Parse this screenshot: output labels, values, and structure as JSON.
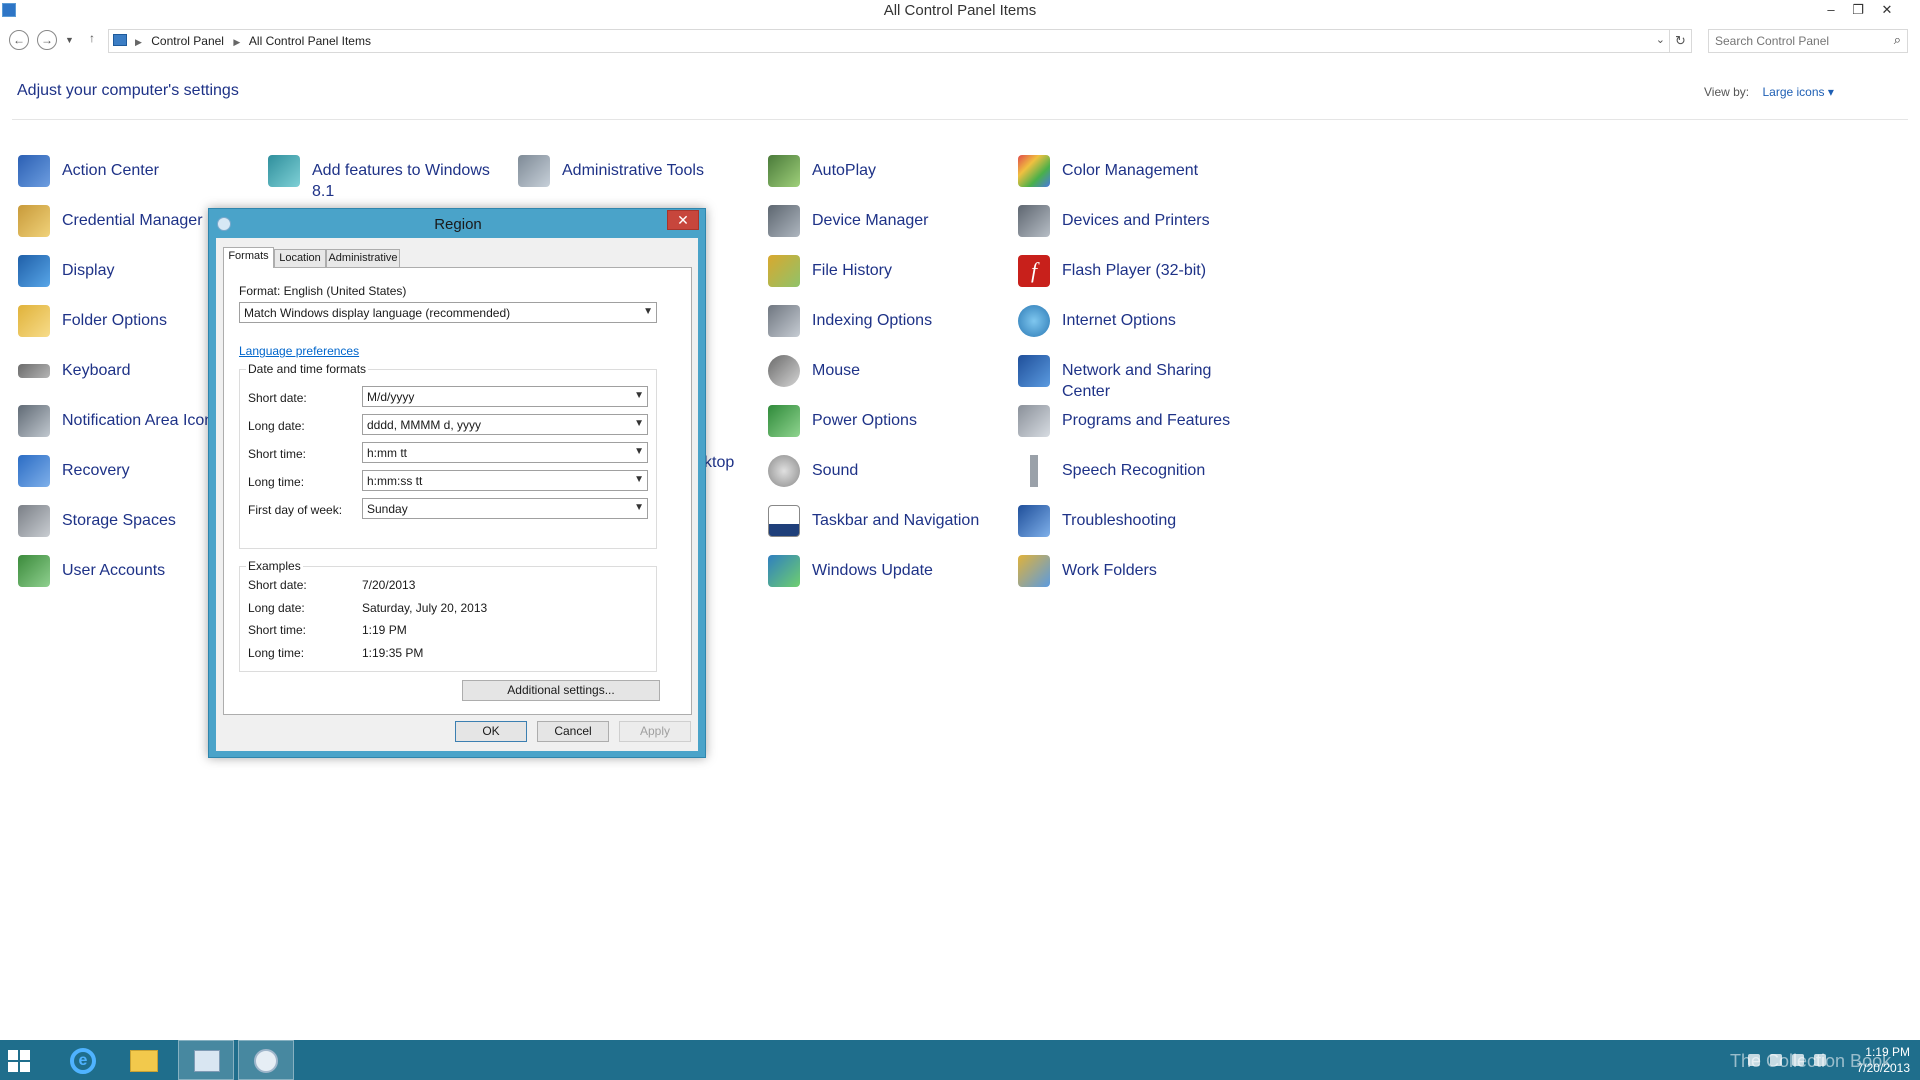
{
  "window": {
    "title": "All Control Panel Items",
    "minimize": "–",
    "restore": "❐",
    "close": "✕"
  },
  "address": {
    "crumbs": [
      "Control Panel",
      "All Control Panel Items"
    ],
    "search_placeholder": "Search Control Panel"
  },
  "header": {
    "heading": "Adjust your computer's settings",
    "view_by_label": "View by:",
    "view_by_value": "Large icons ▾"
  },
  "items": {
    "col1": [
      "Action Center",
      "Credential Manager",
      "Display",
      "Folder Options",
      "Keyboard",
      "Notification Area Icons",
      "Recovery",
      "Storage Spaces",
      "User Accounts"
    ],
    "col2": [
      "Add features to Windows 8.1"
    ],
    "col3": [
      "Administrative Tools",
      "ktop"
    ],
    "col4": [
      "AutoPlay",
      "Device Manager",
      "File History",
      "Indexing Options",
      "Mouse",
      "Power Options",
      "Sound",
      "Taskbar and Navigation",
      "Windows Update"
    ],
    "col5": [
      "Color Management",
      "Devices and Printers",
      "Flash Player (32-bit)",
      "Internet Options",
      "Network and Sharing Center",
      "Programs and Features",
      "Speech Recognition",
      "Troubleshooting",
      "Work Folders"
    ]
  },
  "dialog": {
    "title": "Region",
    "close": "✕",
    "tabs": [
      "Formats",
      "Location",
      "Administrative"
    ],
    "format_label": "Format: English (United States)",
    "format_value": "Match Windows display language (recommended)",
    "language_link": "Language preferences",
    "datetime_group": "Date and time formats",
    "fields": [
      {
        "label": "Short date:",
        "value": "M/d/yyyy"
      },
      {
        "label": "Long date:",
        "value": "dddd, MMMM d, yyyy"
      },
      {
        "label": "Short time:",
        "value": "h:mm tt"
      },
      {
        "label": "Long time:",
        "value": "h:mm:ss tt"
      },
      {
        "label": "First day of week:",
        "value": "Sunday"
      }
    ],
    "examples_group": "Examples",
    "examples": [
      {
        "label": "Short date:",
        "value": "7/20/2013"
      },
      {
        "label": "Long date:",
        "value": "Saturday, July 20, 2013"
      },
      {
        "label": "Short time:",
        "value": "1:19 PM"
      },
      {
        "label": "Long time:",
        "value": "1:19:35 PM"
      }
    ],
    "additional_settings": "Additional settings...",
    "ok": "OK",
    "cancel": "Cancel",
    "apply": "Apply"
  },
  "taskbar": {
    "watermark": "The Collection Book",
    "time": "1:19 PM",
    "date": "7/20/2013"
  },
  "colors": {
    "link_blue": "#1e3287",
    "dialog_frame": "#4aa3c9",
    "taskbar": "#1f6e8c"
  }
}
